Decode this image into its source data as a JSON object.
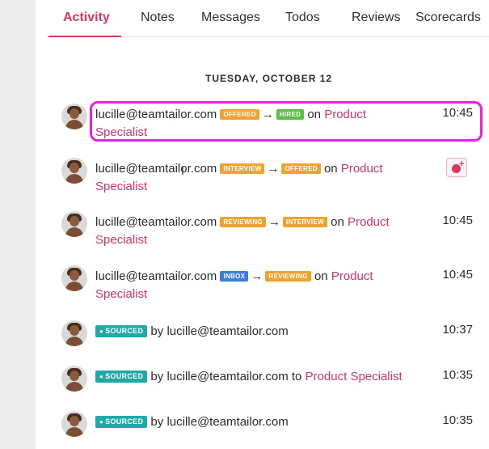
{
  "tabs": [
    "Activity",
    "Notes",
    "Messages",
    "Todos",
    "Reviews",
    "Scorecards"
  ],
  "date_header": "TUESDAY, OCTOBER 12",
  "activities": [
    {
      "email": "lucille@teamtailor.com",
      "from": "OFFERED",
      "to": "HIRED",
      "on": "on",
      "job1": "Product",
      "job2": "Specialist",
      "time": "10:45"
    },
    {
      "email": "lucille@teamtailor.com",
      "from": "INTERVIEW",
      "to": "OFFERED",
      "on": "on",
      "job1": "Product",
      "job2": "Specialist",
      "time": ""
    },
    {
      "email": "lucille@teamtailor.com",
      "from": "REVIEWING",
      "to": "INTERVIEW",
      "on": "on",
      "job1": "Product",
      "job2": "Specialist",
      "time": "10:45"
    },
    {
      "email": "lucille@teamtailor.com",
      "from": "INBOX",
      "to": "REVIEWING",
      "on": "on",
      "job1": "Product",
      "job2": "Specialist",
      "time": "10:45"
    },
    {
      "badge": "SOURCED",
      "by": "by",
      "email": "lucille@teamtailor.com",
      "time": "10:37"
    },
    {
      "badge": "SOURCED",
      "by": "by",
      "email": "lucille@teamtailor.com",
      "to": "to",
      "job": "Product Specialist",
      "time": "10:35"
    },
    {
      "badge": "SOURCED",
      "by": "by",
      "email": "lucille@teamtailor.com",
      "time": "10:35"
    }
  ],
  "colors": {
    "accent": "#e0345e",
    "offered": "#f0a22e",
    "hired": "#5ac045",
    "inbox": "#3d7be0",
    "sourced": "#1fa9a8",
    "highlight": "#ee1fe0"
  }
}
